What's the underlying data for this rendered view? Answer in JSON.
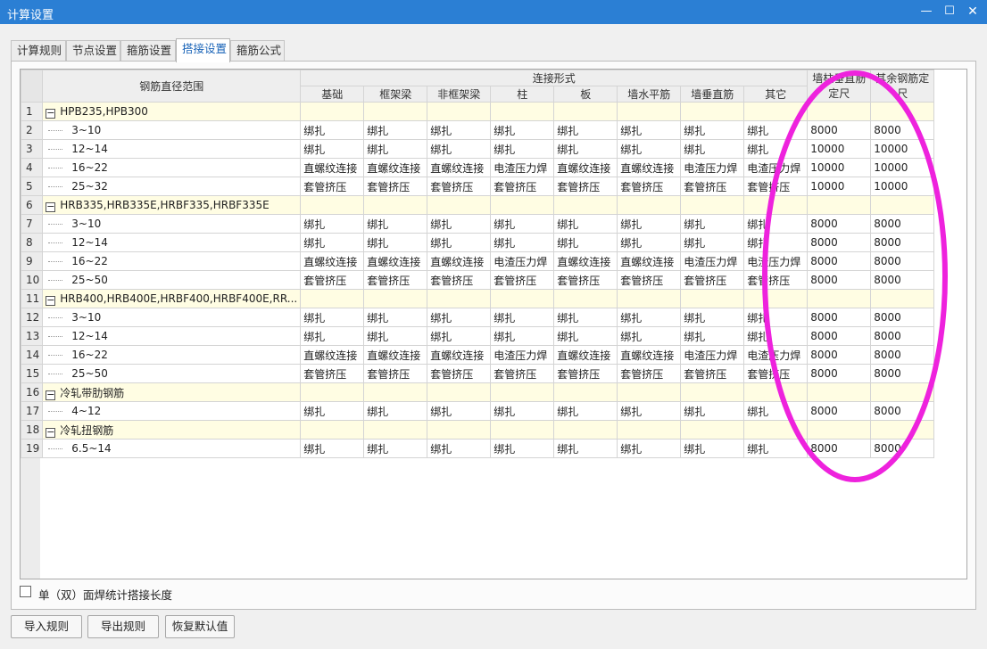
{
  "window": {
    "title": "计算设置",
    "min_glyph": "—",
    "max_glyph": "☐",
    "close_glyph": "✕"
  },
  "tabs": [
    "计算规则",
    "节点设置",
    "箍筋设置",
    "搭接设置",
    "箍筋公式"
  ],
  "active_tab": 3,
  "table": {
    "col_range": "钢筋直径范围",
    "col_group": "连接形式",
    "sub_cols": [
      "基础",
      "框架梁",
      "非框架梁",
      "柱",
      "板",
      "墙水平筋",
      "墙垂直筋",
      "其它"
    ],
    "col_wall_len": "墙柱垂直筋定尺",
    "col_other_len": "其余钢筋定尺",
    "expander_glyph": "−",
    "rows": [
      {
        "n": "1",
        "group": true,
        "label": "HPB235,HPB300"
      },
      {
        "n": "2",
        "label": "3~10",
        "cells": [
          "绑扎",
          "绑扎",
          "绑扎",
          "绑扎",
          "绑扎",
          "绑扎",
          "绑扎",
          "绑扎"
        ],
        "len1": "8000",
        "len2": "8000"
      },
      {
        "n": "3",
        "label": "12~14",
        "cells": [
          "绑扎",
          "绑扎",
          "绑扎",
          "绑扎",
          "绑扎",
          "绑扎",
          "绑扎",
          "绑扎"
        ],
        "len1": "10000",
        "len2": "10000"
      },
      {
        "n": "4",
        "label": "16~22",
        "cells": [
          "直螺纹连接",
          "直螺纹连接",
          "直螺纹连接",
          "电渣压力焊",
          "直螺纹连接",
          "直螺纹连接",
          "电渣压力焊",
          "电渣压力焊"
        ],
        "len1": "10000",
        "len2": "10000"
      },
      {
        "n": "5",
        "label": "25~32",
        "cells": [
          "套管挤压",
          "套管挤压",
          "套管挤压",
          "套管挤压",
          "套管挤压",
          "套管挤压",
          "套管挤压",
          "套管挤压"
        ],
        "len1": "10000",
        "len2": "10000"
      },
      {
        "n": "6",
        "group": true,
        "label": "HRB335,HRB335E,HRBF335,HRBF335E"
      },
      {
        "n": "7",
        "label": "3~10",
        "cells": [
          "绑扎",
          "绑扎",
          "绑扎",
          "绑扎",
          "绑扎",
          "绑扎",
          "绑扎",
          "绑扎"
        ],
        "len1": "8000",
        "len2": "8000"
      },
      {
        "n": "8",
        "label": "12~14",
        "cells": [
          "绑扎",
          "绑扎",
          "绑扎",
          "绑扎",
          "绑扎",
          "绑扎",
          "绑扎",
          "绑扎"
        ],
        "len1": "8000",
        "len2": "8000"
      },
      {
        "n": "9",
        "label": "16~22",
        "cells": [
          "直螺纹连接",
          "直螺纹连接",
          "直螺纹连接",
          "电渣压力焊",
          "直螺纹连接",
          "直螺纹连接",
          "电渣压力焊",
          "电渣压力焊"
        ],
        "len1": "8000",
        "len2": "8000"
      },
      {
        "n": "10",
        "label": "25~50",
        "cells": [
          "套管挤压",
          "套管挤压",
          "套管挤压",
          "套管挤压",
          "套管挤压",
          "套管挤压",
          "套管挤压",
          "套管挤压"
        ],
        "len1": "8000",
        "len2": "8000"
      },
      {
        "n": "11",
        "group": true,
        "label": "HRB400,HRB400E,HRBF400,HRBF400E,RR..."
      },
      {
        "n": "12",
        "label": "3~10",
        "cells": [
          "绑扎",
          "绑扎",
          "绑扎",
          "绑扎",
          "绑扎",
          "绑扎",
          "绑扎",
          "绑扎"
        ],
        "len1": "8000",
        "len2": "8000"
      },
      {
        "n": "13",
        "label": "12~14",
        "cells": [
          "绑扎",
          "绑扎",
          "绑扎",
          "绑扎",
          "绑扎",
          "绑扎",
          "绑扎",
          "绑扎"
        ],
        "len1": "8000",
        "len2": "8000"
      },
      {
        "n": "14",
        "label": "16~22",
        "cells": [
          "直螺纹连接",
          "直螺纹连接",
          "直螺纹连接",
          "电渣压力焊",
          "直螺纹连接",
          "直螺纹连接",
          "电渣压力焊",
          "电渣压力焊"
        ],
        "len1": "8000",
        "len2": "8000"
      },
      {
        "n": "15",
        "label": "25~50",
        "cells": [
          "套管挤压",
          "套管挤压",
          "套管挤压",
          "套管挤压",
          "套管挤压",
          "套管挤压",
          "套管挤压",
          "套管挤压"
        ],
        "len1": "8000",
        "len2": "8000"
      },
      {
        "n": "16",
        "group": true,
        "label": "冷轧带肋钢筋"
      },
      {
        "n": "17",
        "label": "4~12",
        "cells": [
          "绑扎",
          "绑扎",
          "绑扎",
          "绑扎",
          "绑扎",
          "绑扎",
          "绑扎",
          "绑扎"
        ],
        "len1": "8000",
        "len2": "8000"
      },
      {
        "n": "18",
        "group": true,
        "label": "冷轧扭钢筋"
      },
      {
        "n": "19",
        "label": "6.5~14",
        "cells": [
          "绑扎",
          "绑扎",
          "绑扎",
          "绑扎",
          "绑扎",
          "绑扎",
          "绑扎",
          "绑扎"
        ],
        "len1": "8000",
        "len2": "8000"
      }
    ]
  },
  "options": {
    "single_double_weld_label": "单（双）面焊统计搭接长度",
    "single_double_weld_checked": false
  },
  "buttons": {
    "import": "导入规则",
    "export": "导出规则",
    "restore": "恢复默认值"
  },
  "colors": {
    "titlebar": "#2b7fd4",
    "group_row": "#fffde3",
    "active_tab_text": "#1a64b8",
    "annotation": "#ee22dd"
  },
  "annotation": {
    "shape": "ellipse",
    "target": "定尺 columns"
  }
}
